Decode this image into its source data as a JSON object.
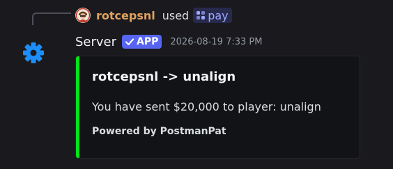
{
  "context": {
    "avatar_icon": "user-avatar-icon",
    "username": "rotcepsnl",
    "used_text": "used",
    "command": "pay",
    "command_icon": "slash-command-icon"
  },
  "message": {
    "avatar_icon": "gear-icon",
    "author": "Server",
    "badge": "APP",
    "badge_icon": "check-icon",
    "timestamp": "2026-08-19 7:33 PM"
  },
  "embed": {
    "accent_color": "#00e41b",
    "title": "rotcepsnl -> unalign",
    "description": "You have sent $20,000 to player: unalign",
    "footer": "Powered by PostmanPat"
  },
  "colors": {
    "background": "#1a1a1e",
    "username": "#e0a25e",
    "command_chip_bg": "#272a4d",
    "command_chip_text": "#9ea8ff",
    "app_badge": "#5865f2",
    "gear_icon": "#1c8ef9"
  }
}
